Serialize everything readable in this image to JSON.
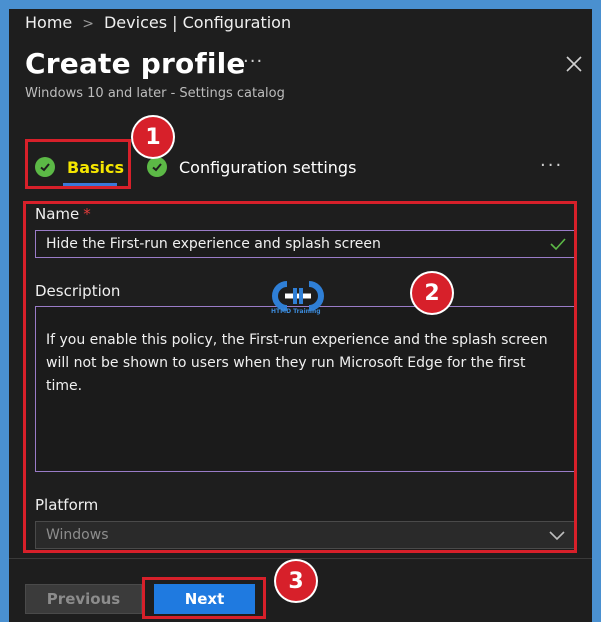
{
  "breadcrumb": {
    "home": "Home",
    "separator": ">",
    "current": "Devices | Configuration"
  },
  "header": {
    "title": "Create profile",
    "more": "···",
    "subtitle": "Windows 10 and later - Settings catalog"
  },
  "tabs": [
    {
      "label": "Basics",
      "active": true
    },
    {
      "label": "Configuration settings",
      "active": false
    }
  ],
  "tabs_more": "···",
  "form": {
    "name_label": "Name",
    "required_mark": "*",
    "name_value": "Hide the First-run experience and splash screen",
    "description_label": "Description",
    "description_value": "If you enable this policy, the First-run experience and the splash screen will not be shown to users when they run Microsoft Edge for the first time.",
    "platform_label": "Platform",
    "platform_value": "Windows"
  },
  "watermark": {
    "text": "HTMD Training"
  },
  "annotations": {
    "badge1": "1",
    "badge2": "2",
    "badge3": "3"
  },
  "footer": {
    "previous_label": "Previous",
    "next_label": "Next"
  },
  "colors": {
    "accent": "#1f7ae0",
    "highlight": "#d7202a",
    "success": "#5cb946",
    "active_tab_text": "#f5e600"
  }
}
